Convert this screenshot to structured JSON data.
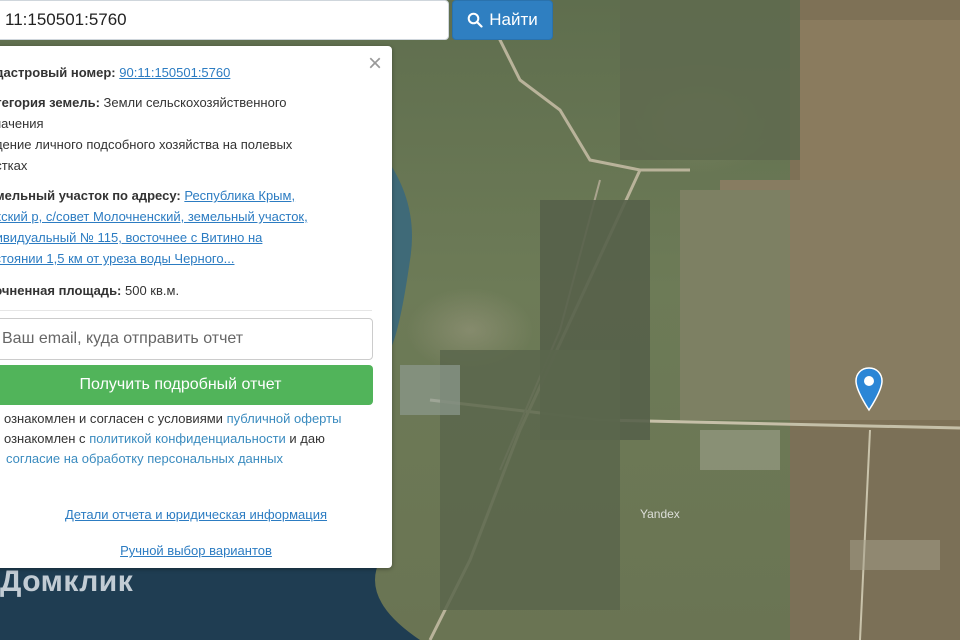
{
  "search": {
    "value": "11:150501:5760",
    "button_label": "Найти"
  },
  "panel": {
    "cadastral_label": "адастровый номер:",
    "cadastral_value": "90:11:150501:5760",
    "category_label": "атегория земель:",
    "category_value_1": " Земли сельскохозяйственного",
    "category_value_2": "значения",
    "usage_1": "едение личного подсобного хозяйства на полевых",
    "usage_2": "астках",
    "address_label": "емельный участок по адресу:",
    "address_1": "Республика Крым,",
    "address_2": "акский р, с/совет Молочненский, земельный участок,",
    "address_3": "дивидуальный № 115, восточнее с Витино на",
    "address_4": "сстоянии 1,5 км от уреза воды Черного...",
    "area_label": "точненная площадь:",
    "area_value": " 500 кв.м.",
    "email_placeholder": "Ваш email, куда отправить отчет",
    "report_button": "Получить подробный отчет",
    "consent_1_text": "ознакомлен и согласен с условиями ",
    "consent_1_link": "публичной оферты",
    "consent_2_text": "ознакомлен с ",
    "consent_2_link": "политикой конфиденциальности",
    "consent_2_tail": " и даю",
    "consent_3_link": "согласие на обработку персональных данных",
    "details_link": "Детали отчета и юридическая информация",
    "manual_link": "Ручной выбор вариантов"
  },
  "map": {
    "watermark": "Домклик",
    "provider": "Yandex"
  },
  "colors": {
    "accent": "#2f7fc1",
    "success": "#51b45a",
    "link": "#2c7cc2",
    "pin": "#2b86d6"
  },
  "icons": [
    "search-icon",
    "close-icon",
    "map-pin-icon"
  ]
}
